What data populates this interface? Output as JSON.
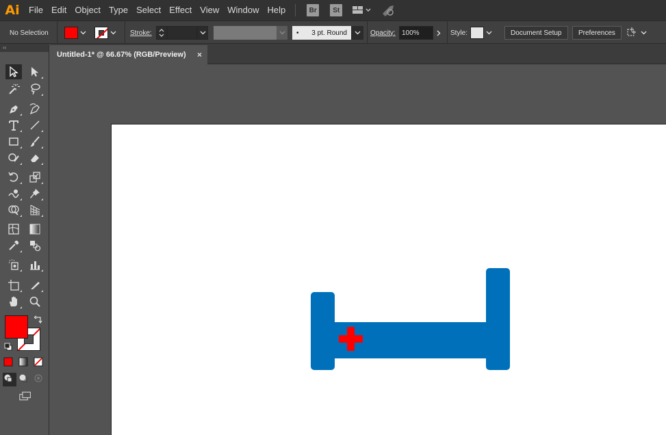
{
  "app": {
    "logo": "Ai"
  },
  "menu": [
    "File",
    "Edit",
    "Object",
    "Type",
    "Select",
    "Effect",
    "View",
    "Window",
    "Help"
  ],
  "badges": {
    "bridge": "Br",
    "stock": "St"
  },
  "control_bar": {
    "selection_status": "No Selection",
    "stroke_label": "Stroke:",
    "brush": "3 pt. Round",
    "brush_dot": "•",
    "opacity_label": "Opacity:",
    "opacity_value": "100%",
    "style_label": "Style:",
    "document_setup": "Document Setup",
    "preferences": "Preferences"
  },
  "toolpanel": {
    "collapse": "‹‹"
  },
  "document": {
    "tab_title": "Untitled-1* @ 66.67% (RGB/Preview)",
    "close": "×"
  },
  "colors": {
    "fill": "#ff0000",
    "stroke": "none",
    "shape_blue": "#0070bb",
    "cross_red": "#ff0000"
  },
  "tools": [
    "selection-tool",
    "direct-selection-tool",
    "magic-wand-tool",
    "lasso-tool",
    "pen-tool",
    "curvature-tool",
    "type-tool",
    "line-segment-tool",
    "rectangle-tool",
    "paintbrush-tool",
    "shaper-tool",
    "eraser-tool",
    "rotate-tool",
    "scale-tool",
    "warp-tool",
    "puppet-warp-tool",
    "shape-builder-tool",
    "perspective-grid-tool",
    "mesh-tool",
    "gradient-tool",
    "eyedropper-tool",
    "blend-tool",
    "symbol-sprayer-tool",
    "column-graph-tool",
    "artboard-tool",
    "slice-tool",
    "hand-tool",
    "zoom-tool"
  ]
}
